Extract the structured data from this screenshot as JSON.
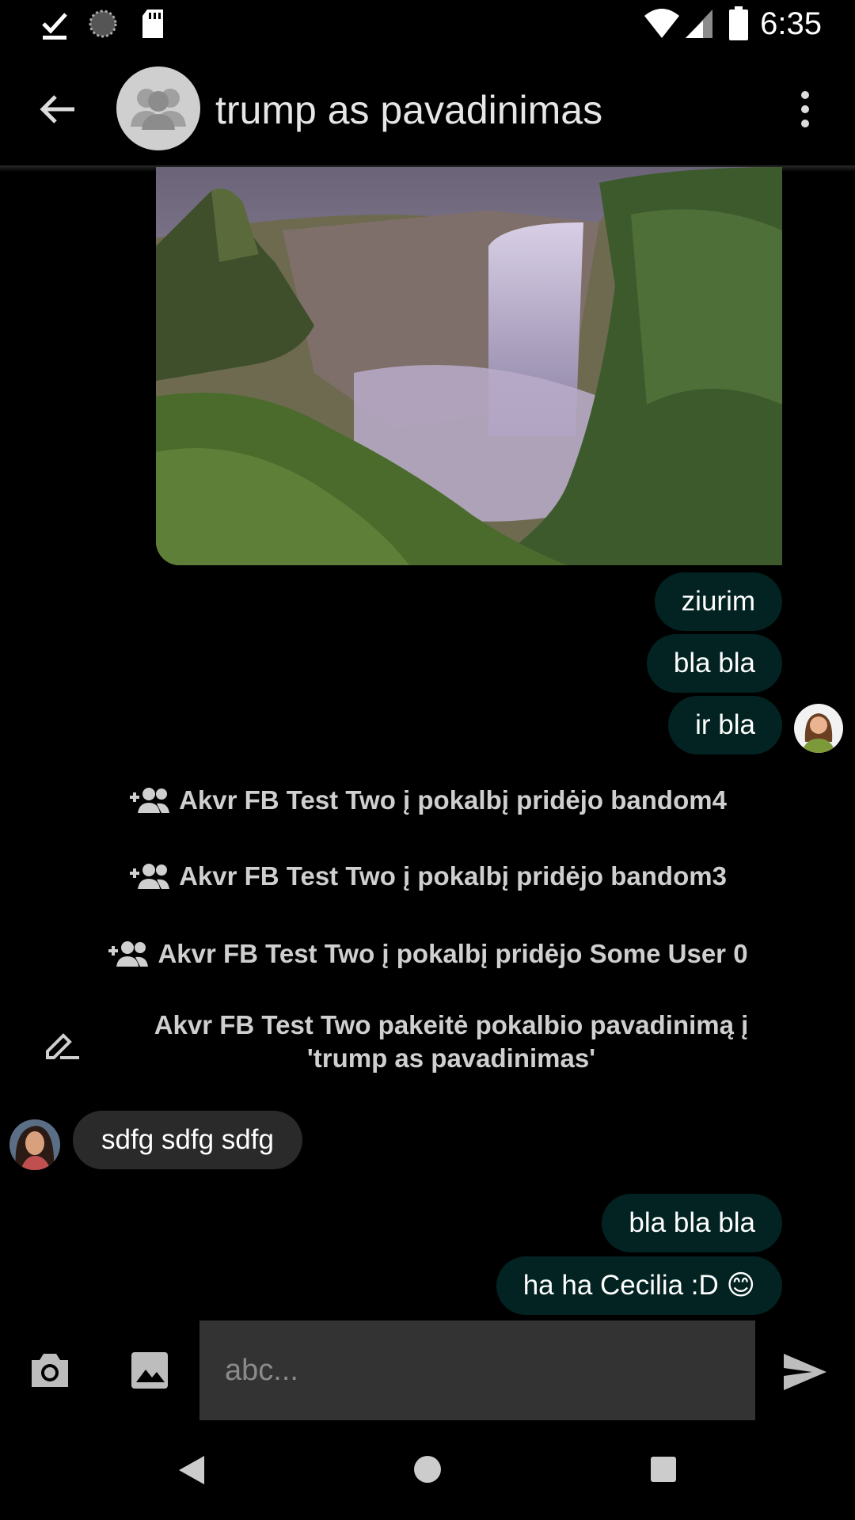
{
  "status_bar": {
    "time": "6:35",
    "icons": [
      "check-icon",
      "loading-icon",
      "sd-card-icon",
      "wifi-icon",
      "signal-icon",
      "battery-icon"
    ]
  },
  "app_bar": {
    "title": "trump as pavadinimas",
    "back_icon": "arrow-back-icon",
    "menu_icon": "more-vert-icon"
  },
  "messages": {
    "out_1": "ziurim",
    "out_2": "bla bla",
    "out_3": "ir bla",
    "sys_1": "Akvr FB Test Two į pokalbį pridėjo bandom4",
    "sys_2": "Akvr FB Test Two į pokalbį pridėjo bandom3",
    "sys_3": "Akvr FB Test Two į pokalbį pridėjo Some User 0",
    "sys_4_line1": "Akvr FB Test Two pakeitė pokalbio pavadinimą į",
    "sys_4_line2": "'trump as pavadinimas'",
    "in_1": "sdfg sdfg sdfg",
    "out_4": "bla bla bla",
    "out_5": "ha ha Cecilia :D 😊"
  },
  "composer": {
    "placeholder": "abc...",
    "camera_icon": "camera-icon",
    "gallery_icon": "image-icon",
    "send_icon": "send-icon"
  },
  "colors": {
    "outgoing_bubble": "#022322",
    "incoming_bubble": "#2a2a2a",
    "input_bg": "#333333"
  }
}
